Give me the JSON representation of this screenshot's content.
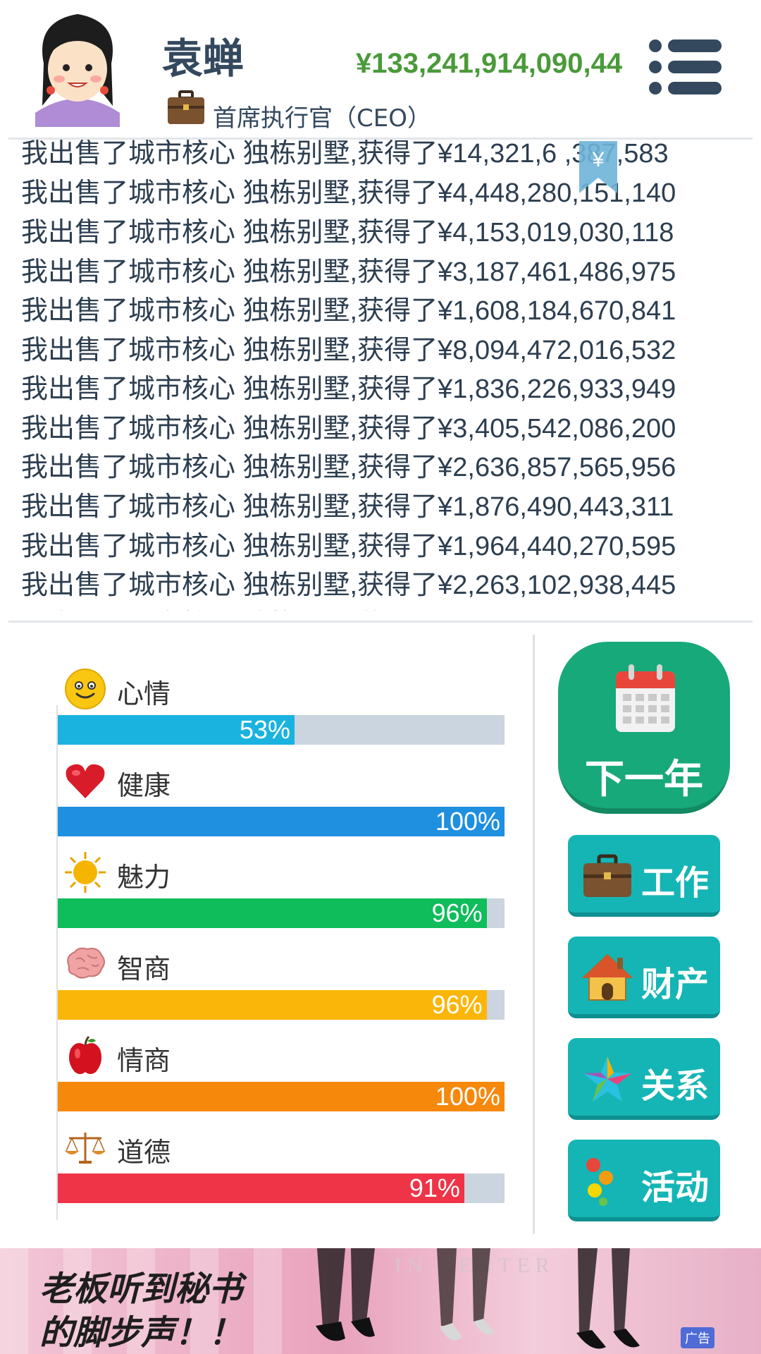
{
  "header": {
    "name": "袁蝉",
    "money": "¥133,241,914,090,44",
    "job_title": "首席执行官（CEO）",
    "money_color": "#4a9a3a"
  },
  "log": {
    "lines": [
      "我出售了城市核心 独栋别墅,获得了¥14,321,6  ,387,583",
      "我出售了城市核心 独栋别墅,获得了¥4,448,280,151,140",
      "我出售了城市核心 独栋别墅,获得了¥4,153,019,030,118",
      "我出售了城市核心 独栋别墅,获得了¥3,187,461,486,975",
      "我出售了城市核心 独栋别墅,获得了¥1,608,184,670,841",
      "我出售了城市核心 独栋别墅,获得了¥8,094,472,016,532",
      "我出售了城市核心 独栋别墅,获得了¥1,836,226,933,949",
      "我出售了城市核心 独栋别墅,获得了¥3,405,542,086,200",
      "我出售了城市核心 独栋别墅,获得了¥2,636,857,565,956",
      "我出售了城市核心 独栋别墅,获得了¥1,876,490,443,311",
      "我出售了城市核心 独栋别墅,获得了¥1,964,440,270,595",
      "我出售了城市核心 独栋别墅,获得了¥2,263,102,938,445",
      "我出售了城市核心 独栋别墅,获得了"
    ],
    "bookmark_symbol": "¥"
  },
  "stats": [
    {
      "label": "心情",
      "percent": 53,
      "text": "53%",
      "color": "#1ab3df",
      "icon": "smiley-icon"
    },
    {
      "label": "健康",
      "percent": 100,
      "text": "100%",
      "color": "#1f8fe0",
      "icon": "heart-icon"
    },
    {
      "label": "魅力",
      "percent": 96,
      "text": "96%",
      "color": "#0fbd5a",
      "icon": "sun-icon"
    },
    {
      "label": "智商",
      "percent": 96,
      "text": "96%",
      "color": "#fbb60a",
      "icon": "brain-icon"
    },
    {
      "label": "情商",
      "percent": 100,
      "text": "100%",
      "color": "#f6880c",
      "icon": "apple-icon"
    },
    {
      "label": "道德",
      "percent": 91,
      "text": "91%",
      "color": "#ef3447",
      "icon": "scales-icon"
    }
  ],
  "buttons": {
    "next_year": "下一年",
    "work": "工作",
    "assets": "财产",
    "relations": "关系",
    "activities": "活动"
  },
  "ad": {
    "line1": "老板听到秘书",
    "line2": "的脚步声！！",
    "badge": "广告"
  }
}
